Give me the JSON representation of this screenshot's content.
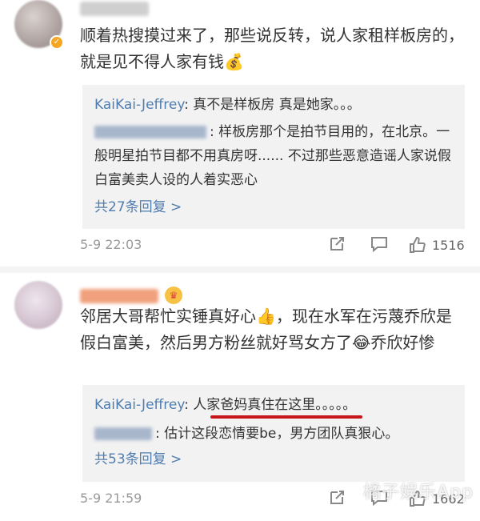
{
  "comments": [
    {
      "text": "顺着热搜摸过来了，那些说反转，说人家租样板房的，就是见不得人家有钱",
      "emoji": "💰",
      "replies": [
        {
          "author": "KaiKai-Jeffrey",
          "text": "真不是样板房 真是她家。。。"
        },
        {
          "text": "样板房那个是拍节目用的，在北京。一般明星拍节目都不用真房呀...... 不过那些恶意造谣人家说假白富美卖人设的人着实恶心"
        }
      ],
      "more_replies": "共27条回复 >",
      "timestamp": "5-9 22:03",
      "likes": "1516"
    },
    {
      "text_a": "邻居大哥帮忙实锤真好心",
      "emoji_a": "👍",
      "text_b": "，现在水军在污蔑乔欣是假白富美，然后男方粉丝就好骂女方了",
      "emoji_b": "😂",
      "text_c": "乔欣好惨",
      "replies": [
        {
          "author": "KaiKai-Jeffrey",
          "text": "人家爸妈真住在这里。。。。。"
        },
        {
          "text": "估计这段恋情要be，男方团队真狠心。"
        }
      ],
      "more_replies": "共53条回复 >",
      "timestamp": "5-9 21:59",
      "likes": "1662"
    }
  ],
  "watermark": "橘子娱乐App",
  "colors": {
    "link": "#507daf",
    "underline": "#c7161b",
    "reply_bg": "#f2f2f2"
  }
}
